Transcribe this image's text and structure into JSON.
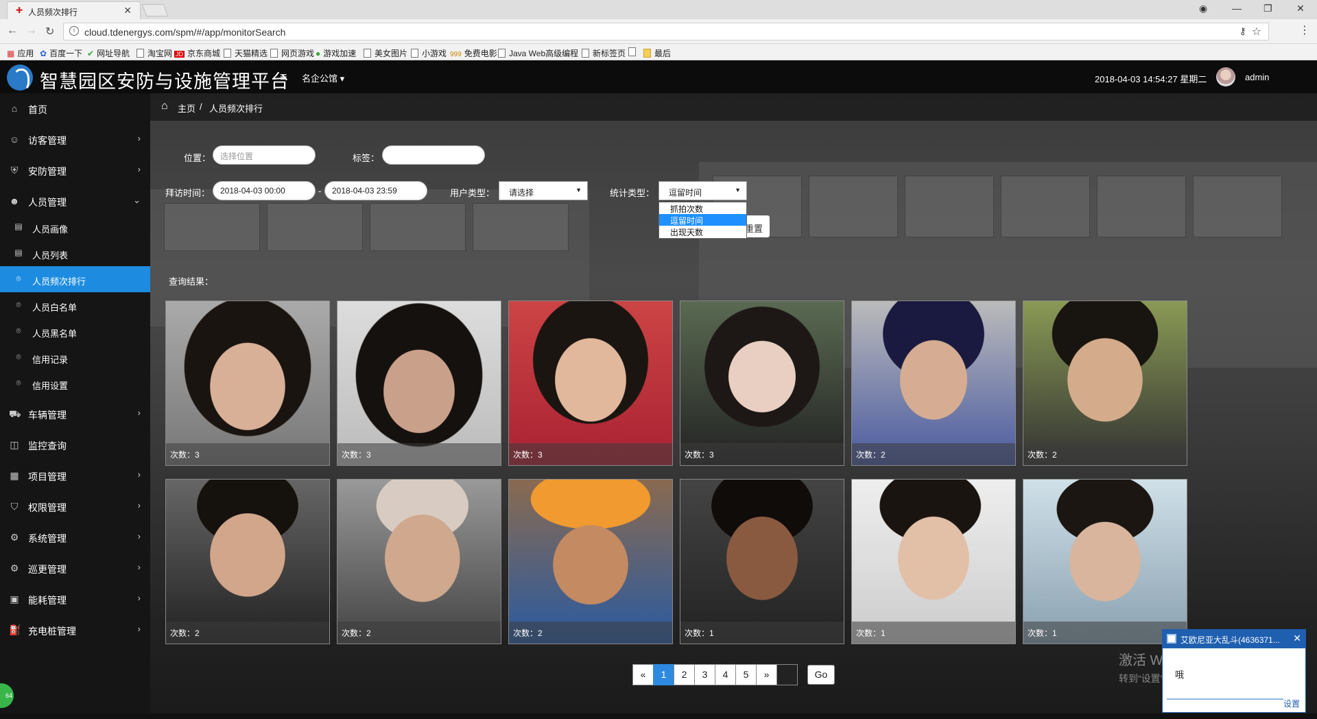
{
  "browser": {
    "tab_title": "人员频次排行",
    "url": "cloud.tdenergys.com/spm/#/app/monitorSearch",
    "bookmarks": [
      "应用",
      "百度一下",
      "网址导航",
      "淘宝网",
      "京东商城",
      "天猫精选",
      "网页游戏",
      "游戏加速",
      "美女图片",
      "小游戏",
      "免费电影",
      "Java Web高级编程",
      "新标签页",
      "最后"
    ]
  },
  "header": {
    "app_title": "智慧园区安防与设施管理平台",
    "org": "名企公馆",
    "datetime": "2018-04-03 14:54:27 星期二",
    "username": "admin"
  },
  "sidebar": {
    "items": [
      {
        "label": "首页",
        "icon": "home-icon"
      },
      {
        "label": "访客管理",
        "icon": "visitor-icon"
      },
      {
        "label": "安防管理",
        "icon": "shield-icon"
      },
      {
        "label": "人员管理",
        "icon": "person-icon"
      },
      {
        "label": "车辆管理",
        "icon": "car-icon"
      },
      {
        "label": "监控查询",
        "icon": "camera-icon"
      },
      {
        "label": "项目管理",
        "icon": "grid-icon"
      },
      {
        "label": "权限管理",
        "icon": "lock-icon"
      },
      {
        "label": "系统管理",
        "icon": "gear-icon"
      },
      {
        "label": "巡更管理",
        "icon": "patrol-icon"
      },
      {
        "label": "能耗管理",
        "icon": "energy-icon"
      },
      {
        "label": "充电桩管理",
        "icon": "charger-icon"
      }
    ],
    "subitems": [
      {
        "label": "人员画像"
      },
      {
        "label": "人员列表"
      },
      {
        "label": "人员频次排行",
        "active": true
      },
      {
        "label": "人员白名单"
      },
      {
        "label": "人员黑名单"
      },
      {
        "label": "信用记录"
      },
      {
        "label": "信用设置"
      }
    ]
  },
  "breadcrumb": {
    "home": "主页",
    "separator": "/",
    "current": "人员频次排行"
  },
  "form": {
    "location_label": "位置：",
    "location_placeholder": "选择位置",
    "tag_label": "标签：",
    "tag_value": "",
    "visit_time_label": "拜访时间：",
    "start_time": "2018-04-03 00:00",
    "dash": "-",
    "end_time": "2018-04-03 23:59",
    "user_type_label": "用户类型：",
    "user_type_value": "请选择",
    "stat_type_label": "统计类型：",
    "stat_type_value": "逗留时间",
    "stat_type_options": [
      "抓拍次数",
      "逗留时间",
      "出现天数"
    ],
    "reset_label": "重置"
  },
  "results": {
    "label": "查询结果：",
    "cards": [
      {
        "count": "次数：3"
      },
      {
        "count": "次数：3"
      },
      {
        "count": "次数：3"
      },
      {
        "count": "次数：3"
      },
      {
        "count": "次数：2"
      },
      {
        "count": "次数：2"
      },
      {
        "count": "次数：2"
      },
      {
        "count": "次数：2"
      },
      {
        "count": "次数：2"
      },
      {
        "count": "次数：1"
      },
      {
        "count": "次数：1"
      },
      {
        "count": "次数：1"
      }
    ]
  },
  "pagination": {
    "prev": "«",
    "pages": [
      "1",
      "2",
      "3",
      "4",
      "5"
    ],
    "next": "»",
    "go": "Go",
    "current_page": "1"
  },
  "windows_activation": {
    "line1": "激活 Windows",
    "line2": "转到“设置”以激活 Windows。"
  },
  "notification": {
    "title": "艾欧尼亚大乱斗(4636371...",
    "message": "哦",
    "settings": "设置"
  },
  "colors": {
    "accent": "#1d8ce0",
    "header_bg": "#0c0c0c",
    "sidebar_bg": "#141414"
  }
}
